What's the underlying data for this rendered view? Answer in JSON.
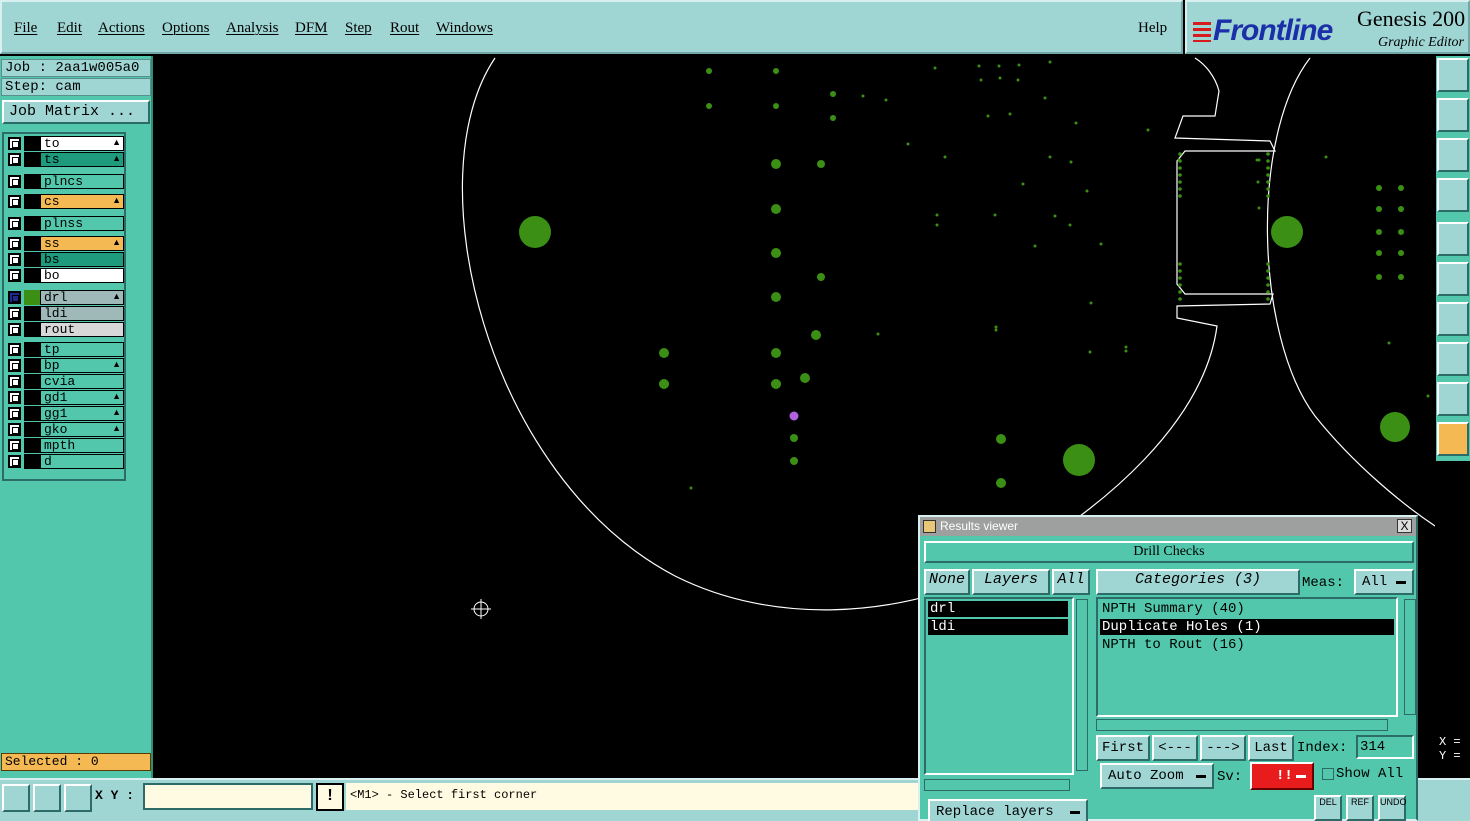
{
  "menubar": {
    "items": [
      "File",
      "Edit",
      "Actions",
      "Options",
      "Analysis",
      "DFM",
      "Step",
      "Rout",
      "Windows"
    ],
    "help": "Help"
  },
  "brand": {
    "logo": "Frontline",
    "product": "Genesis 200",
    "subtitle": "Graphic Editor"
  },
  "left": {
    "job": "Job : 2aa1w005a0",
    "step": "Step: cam",
    "job_matrix": "Job Matrix ...",
    "selected": "Selected : 0",
    "layers": [
      {
        "name": "to",
        "color": "#ffffff",
        "mark": true
      },
      {
        "name": "ts",
        "color": "#1e9a7c",
        "mark": true
      },
      {
        "name": "plncs",
        "color": "#52c7ab",
        "mark": false
      },
      {
        "name": "cs",
        "color": "#f5b954",
        "mark": true
      },
      {
        "name": "plnss",
        "color": "#52c7ab",
        "mark": false
      },
      {
        "name": "ss",
        "color": "#f5b954",
        "mark": true
      },
      {
        "name": "bs",
        "color": "#1e9a7c",
        "mark": false
      },
      {
        "name": "bo",
        "color": "#ffffff",
        "mark": false
      },
      {
        "name": "drl",
        "color": "#9fb8b8",
        "mark": true,
        "active": true
      },
      {
        "name": "ldi",
        "color": "#9fb8b8",
        "mark": false
      },
      {
        "name": "rout",
        "color": "#d8d8d8",
        "mark": false
      },
      {
        "name": "tp",
        "color": "#52c7ab",
        "mark": false
      },
      {
        "name": "bp",
        "color": "#52c7ab",
        "mark": true
      },
      {
        "name": "cvia",
        "color": "#52c7ab",
        "mark": false
      },
      {
        "name": "gd1",
        "color": "#52c7ab",
        "mark": true
      },
      {
        "name": "gg1",
        "color": "#52c7ab",
        "mark": true
      },
      {
        "name": "gko",
        "color": "#52c7ab",
        "mark": true
      },
      {
        "name": "mpth",
        "color": "#52c7ab",
        "mark": false
      },
      {
        "name": "d",
        "color": "#52c7ab",
        "mark": false
      }
    ]
  },
  "status": {
    "xy_label": "X Y :",
    "xy_value": "",
    "excl": "!",
    "prompt": "<M1> - Select first corner"
  },
  "coords": {
    "x": "X =",
    "y": "Y ="
  },
  "results": {
    "title": "Results viewer",
    "close": "X",
    "header": "Drill Checks",
    "none_btn": "None",
    "layers_btn": "Layers",
    "all_btn": "All",
    "categories_btn": "Categories (3)",
    "meas_label": "Meas:",
    "meas_value": "All",
    "layers": [
      "drl",
      "ldi"
    ],
    "categories": [
      {
        "label": "NPTH Summary (40)",
        "selected": false
      },
      {
        "label": "Duplicate Holes (1)",
        "selected": true
      },
      {
        "label": "NPTH to Rout (16)",
        "selected": false
      }
    ],
    "first": "First",
    "prev": "<---",
    "next": "--->",
    "last": "Last",
    "index_label": "Index:",
    "index_value": "314",
    "auto_zoom": "Auto Zoom",
    "sv_label": "Sv:",
    "sv_value": "!!",
    "show_all": "Show All",
    "replace_layers": "Replace layers",
    "del": "DEL",
    "ref": "REF",
    "undo": "UNDO"
  },
  "canvas": {
    "board_outline_color": "#ffffff",
    "pad_color": "#3a8f14",
    "highlight_color": "#b062e0"
  }
}
